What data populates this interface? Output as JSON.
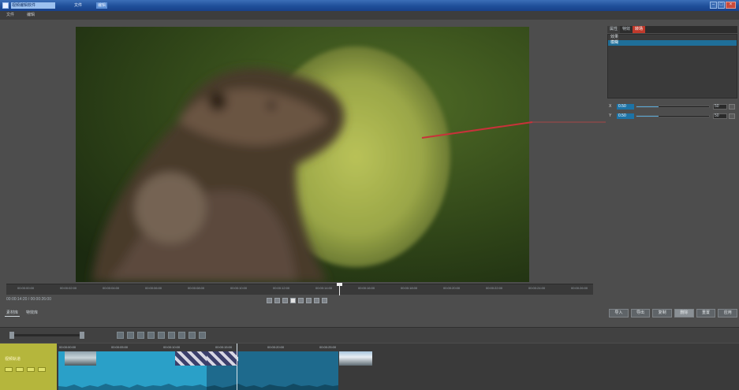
{
  "window": {
    "title": "视频编辑软件",
    "tabs": [
      "文件",
      "编辑"
    ],
    "controls": [
      "–",
      "□",
      "×"
    ]
  },
  "menu": {
    "items": [
      "文件",
      "编辑"
    ]
  },
  "right_panel": {
    "tabs": [
      "属性",
      "特效",
      "转场"
    ],
    "list": [
      {
        "label": "效果"
      },
      {
        "label": "模糊",
        "selected": true
      }
    ],
    "params": [
      {
        "label": "X",
        "value": "0.50",
        "level": 0.3,
        "number": "50"
      },
      {
        "label": "Y",
        "value": "0.50",
        "level": 0.3,
        "number": "50"
      }
    ],
    "buttons": [
      "导入",
      "导出",
      "复制",
      "删除",
      "重置",
      "应用"
    ]
  },
  "ruler": {
    "ticks": [
      "00:00:00:00",
      "00:00:02:00",
      "00:00:04:00",
      "00:00:06:00",
      "00:00:08:00",
      "00:00:10:00",
      "00:00:12:00",
      "00:00:14:00",
      "00:00:16:00",
      "00:00:18:00",
      "00:00:20:00",
      "00:00:22:00",
      "00:00:24:00",
      "00:00:26:00"
    ],
    "timecode": "00:00:14:20 / 00:00:26:00"
  },
  "transport": [
    "prev-icon",
    "rewind-icon",
    "step-back-icon",
    "play-icon",
    "step-forward-icon",
    "forward-icon",
    "next-icon",
    "loop-icon"
  ],
  "side_labels": [
    "素材库",
    "特效库"
  ],
  "timeline": {
    "track_name": "视频轨道",
    "clip_labels": [
      "00:00:00:00",
      "00:00:05:00",
      "00:00:10:00",
      "00:00:15:00",
      "00:00:20:00",
      "00:00:25:00"
    ]
  },
  "colors": {
    "accent": "#1d73a6",
    "clip": "#2aa0c8",
    "clip_dark": "#1e6a8d",
    "track_header": "#b5b63c",
    "annotation_red": "#c8323a"
  }
}
